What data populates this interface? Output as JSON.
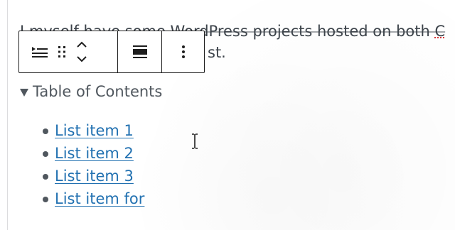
{
  "paragraph": {
    "line1_before": "I myself have some WordPress projects hosted on both ",
    "line1_cut": "C",
    "line2_tail": "st."
  },
  "toolbar": {
    "list_style_icon": "list-indent-icon",
    "drag_handle_icon": "drag-handle-icon",
    "move_up_icon": "chevron-up-icon",
    "move_down_icon": "chevron-down-icon",
    "align_icon": "align-wide-icon",
    "options_icon": "more-vertical-icon"
  },
  "toc": {
    "summary_label": "Table of Contents",
    "items": [
      "List item 1",
      "List item 2",
      "List item 3",
      "List item for"
    ]
  },
  "colors": {
    "link": "#2271b1",
    "text": "#3c434a",
    "toolbar_border": "#1e1e1e"
  }
}
